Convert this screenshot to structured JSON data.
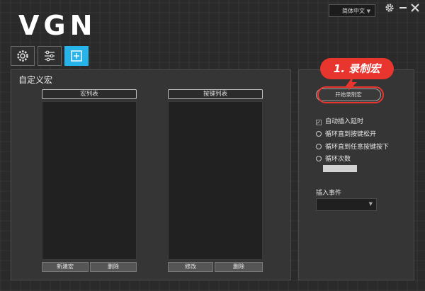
{
  "app": {
    "logo": "VGN"
  },
  "header": {
    "language": "简体中文"
  },
  "macro_panel": {
    "title": "自定义宏",
    "macro_list_header": "宏列表",
    "key_list_header": "按键列表",
    "new_macro": "新建宏",
    "delete_macro": "删除",
    "modify_key": "修改",
    "delete_key": "删除"
  },
  "settings_panel": {
    "record_button": "开始录制宏",
    "auto_delay": "自动插入延时",
    "loop_until_release": "循环直到按键松开",
    "loop_until_any_key": "循环直到任意按键按下",
    "loop_count": "循环次数",
    "insert_event_label": "插入事件"
  },
  "annotation": {
    "callout": "1. 录制宏"
  },
  "colors": {
    "accent": "#27b4ea",
    "callout": "#e8362e"
  }
}
